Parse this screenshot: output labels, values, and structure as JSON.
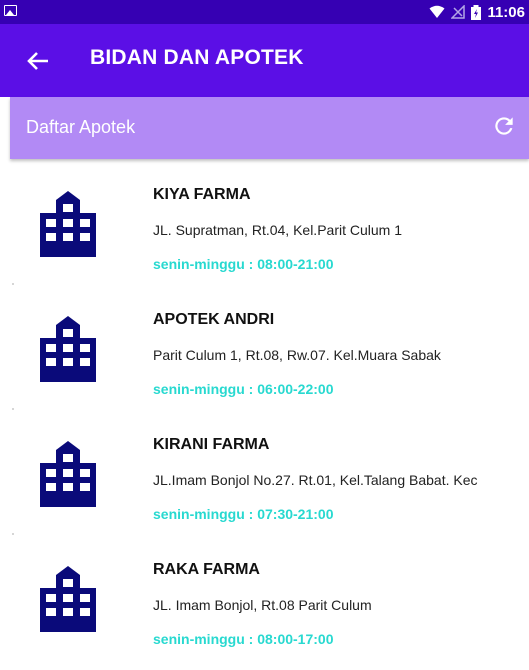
{
  "status_bar": {
    "time": "11:06",
    "icons": [
      "gallery-icon",
      "wifi-icon",
      "no-signal-icon",
      "battery-charging-icon"
    ]
  },
  "app_bar": {
    "title": "BIDAN DAN APOTEK",
    "back_icon": "arrow-back-icon"
  },
  "sub_bar": {
    "title": "Daftar Apotek",
    "refresh_icon": "refresh-icon"
  },
  "items": [
    {
      "name": "KIYA FARMA",
      "address": "JL. Supratman, Rt.04, Kel.Parit Culum 1",
      "hours": "senin-minggu : 08:00-21:00",
      "icon": "building-icon"
    },
    {
      "name": "APOTEK ANDRI",
      "address": "Parit Culum 1, Rt.08, Rw.07. Kel.Muara Sabak",
      "hours": "senin-minggu : 06:00-22:00",
      "icon": "building-icon"
    },
    {
      "name": "KIRANI FARMA",
      "address": "JL.Imam Bonjol No.27. Rt.01, Kel.Talang Babat. Kec",
      "hours": "senin-minggu : 07:30-21:00",
      "icon": "building-icon"
    },
    {
      "name": "RAKA FARMA",
      "address": "JL. Imam Bonjol, Rt.08 Parit Culum",
      "hours": "senin-minggu : 08:00-17:00",
      "icon": "building-icon"
    }
  ],
  "colors": {
    "status_bar": "#3600b3",
    "app_bar": "#5b0fe6",
    "sub_bar": "#b28af5",
    "icon": "#0a0a7a",
    "hours_text": "#28d9d0"
  }
}
